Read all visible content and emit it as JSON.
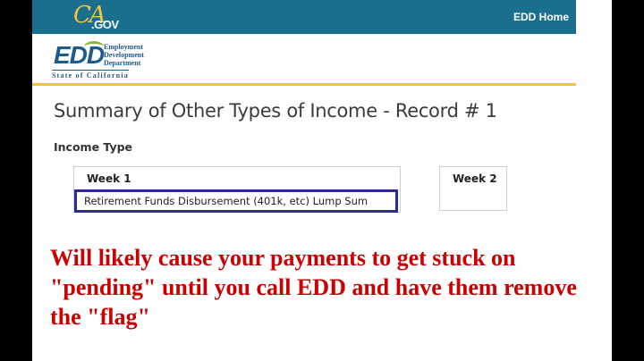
{
  "header": {
    "ca_logo_text": "CA",
    "ca_logo_gov": ".GOV",
    "nav_link": "EDD Home"
  },
  "edd_logo": {
    "letters": "EDD",
    "dept_line1": "Employment",
    "dept_line2": "Development",
    "dept_line3": "Department",
    "state_line": "State of California"
  },
  "main": {
    "title": "Summary of Other Types of Income - Record # 1",
    "income_type_label": "Income Type",
    "weeks": [
      {
        "label": "Week 1",
        "value": "Retirement Funds Disbursement (401k, etc) Lump Sum"
      },
      {
        "label": "Week 2",
        "value": ""
      }
    ]
  },
  "overlay": {
    "caption": "Will likely cause your payments to get stuck on \"pending\" until you call EDD and have them remove the \"flag\""
  },
  "colors": {
    "topbar": "#1a6e8e",
    "gold": "#f2c53d",
    "caption_red": "#cc0000",
    "select_border": "#2a2a9a"
  }
}
